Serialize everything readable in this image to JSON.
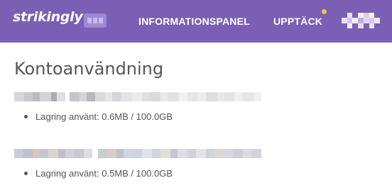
{
  "header": {
    "logo_text": "strikingly",
    "nav": [
      {
        "label": "INFORMATIONSPANEL"
      },
      {
        "label": "UPPTÄCK"
      }
    ],
    "background_color": "#7a5fb5",
    "notification_dot_color": "#f6c23e"
  },
  "main": {
    "title": "Kontoanvändning",
    "sites": [
      {
        "usage": "Lagring använt: 0.6MB / 100.0GB"
      },
      {
        "usage": "Lagring använt: 0.5MB / 100.0GB"
      }
    ]
  }
}
